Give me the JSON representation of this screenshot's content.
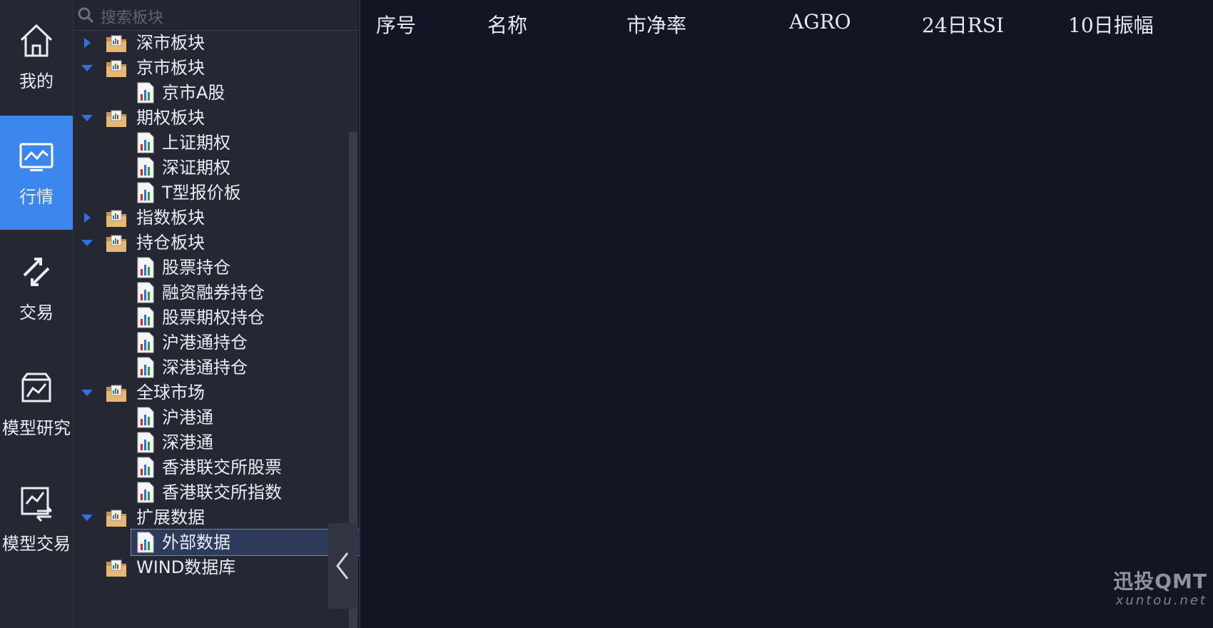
{
  "nav": {
    "items": [
      {
        "label": "我的",
        "icon": "home-icon"
      },
      {
        "label": "行情",
        "icon": "market-chart-icon"
      },
      {
        "label": "交易",
        "icon": "exchange-arrows-icon"
      },
      {
        "label": "模型研究",
        "icon": "model-research-icon"
      },
      {
        "label": "模型交易",
        "icon": "model-trade-icon"
      }
    ],
    "active_index": 1,
    "active_color": "#3b87ee"
  },
  "search": {
    "placeholder": "搜索板块",
    "icon": "search-icon"
  },
  "tree": {
    "nodes": [
      {
        "label": "深市板块",
        "level": 0,
        "expand": "collapsed"
      },
      {
        "label": "京市板块",
        "level": 0,
        "expand": "expanded"
      },
      {
        "label": "京市A股",
        "level": 1
      },
      {
        "label": "期权板块",
        "level": 0,
        "expand": "expanded"
      },
      {
        "label": "上证期权",
        "level": 1
      },
      {
        "label": "深证期权",
        "level": 1
      },
      {
        "label": "T型报价板",
        "level": 1
      },
      {
        "label": "指数板块",
        "level": 0,
        "expand": "collapsed"
      },
      {
        "label": "持仓板块",
        "level": 0,
        "expand": "expanded"
      },
      {
        "label": "股票持仓",
        "level": 1
      },
      {
        "label": "融资融券持仓",
        "level": 1
      },
      {
        "label": "股票期权持仓",
        "level": 1
      },
      {
        "label": "沪港通持仓",
        "level": 1
      },
      {
        "label": "深港通持仓",
        "level": 1
      },
      {
        "label": "全球市场",
        "level": 0,
        "expand": "expanded"
      },
      {
        "label": "沪港通",
        "level": 1
      },
      {
        "label": "深港通",
        "level": 1
      },
      {
        "label": "香港联交所股票",
        "level": 1
      },
      {
        "label": "香港联交所指数",
        "level": 1
      },
      {
        "label": "扩展数据",
        "level": 0,
        "expand": "expanded"
      },
      {
        "label": "外部数据",
        "level": 1,
        "selected": true
      },
      {
        "label": "WIND数据库",
        "level": 0
      }
    ]
  },
  "table": {
    "columns": [
      "序号",
      "名称",
      "市净率",
      "AGRO",
      "24日RSI",
      "10日振幅"
    ]
  },
  "brand": {
    "name": "迅投QMT",
    "url": "xuntou.net"
  },
  "colors": {
    "accent": "#3b87ee",
    "tree_arrow": "#2e72e8",
    "background": "#121624"
  }
}
